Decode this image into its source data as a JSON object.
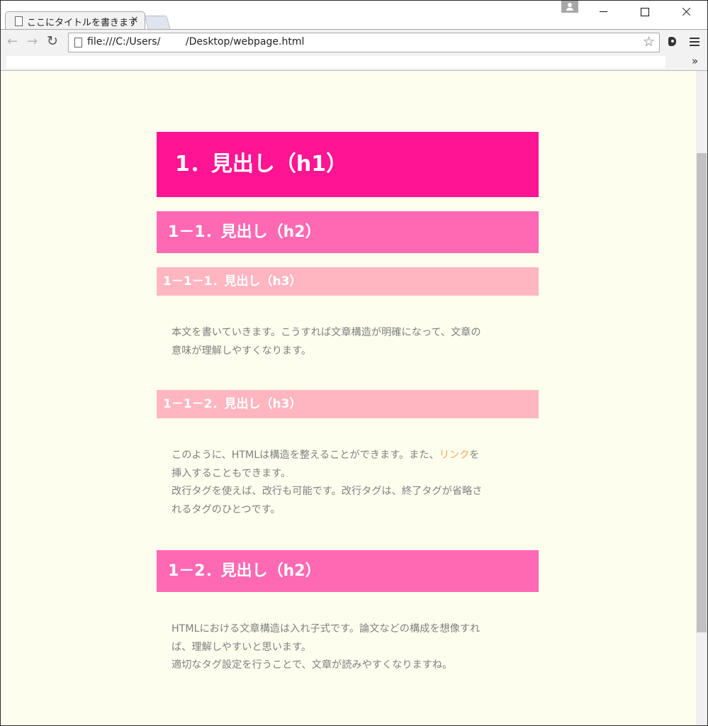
{
  "browser": {
    "tab_title": "ここにタイトルを書きます",
    "tab_close": "×",
    "url": "file:///C:/Users/        /Desktop/webpage.html",
    "back": "←",
    "forward": "→",
    "reload": "↻",
    "star": "☆",
    "bookmark_chevrons": "»"
  },
  "page": {
    "h1": "1．見出し（h1）",
    "h2_first": "1－1．見出し（h2）",
    "h3_first": "1－1－1．見出し（h3）",
    "para1_line1": "本文を書いていきます。こうすれば文章構造が明確になって、文章の",
    "para1_line2": "意味が理解しやすくなります。",
    "h3_second": "1－1－2．見出し（h3）",
    "para2_line1_before": "このように、HTMLは構造を整えることができます。また、",
    "para2_link": "リンク",
    "para2_line1_after": "を",
    "para2_line2": "挿入することもできます。",
    "para2_line3": "改行タグを使えば、改行も可能です。改行タグは、終了タグが省略さ",
    "para2_line4": "れるタグのひとつです。",
    "h2_second": "1－2．見出し（h2）",
    "para3_line1": "HTMLにおける文章構造は入れ子式です。論文などの構成を想像すれ",
    "para3_line2": "ば、理解しやすいと思います。",
    "para3_line3": "適切なタグ設定を行うことで、文章が読みやすくなりますね。"
  },
  "colors": {
    "h1_bg": "#ff1493",
    "h2_bg": "#ff69b4",
    "h3_bg": "#ffb6c1",
    "page_bg": "#fdfeee",
    "body_text": "#808080",
    "link": "#ffa54f"
  }
}
